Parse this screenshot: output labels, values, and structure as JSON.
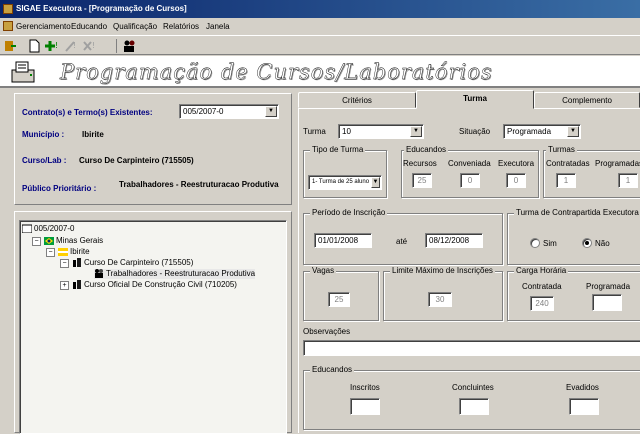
{
  "window": {
    "title": "SIGAE Executora - [Programação de Cursos]"
  },
  "menu": {
    "items": [
      "Gerenciamento",
      "Educando",
      "Qualificação",
      "Relatórios",
      "Janela"
    ]
  },
  "banner": {
    "title": "Programação de Cursos/Laboratórios"
  },
  "left": {
    "contract_label": "Contrato(s) e Termo(s) Existentes:",
    "contract_value": "005/2007-0",
    "municipio_label": "Município :",
    "municipio_value": "Ibirite",
    "curso_label": "Curso/Lab :",
    "curso_value": "Curso De Carpinteiro (715505)",
    "publico_label": "Público Prioritário :",
    "publico_value": "Trabalhadores - Reestruturacao Produtiva"
  },
  "tree": {
    "root": "005/2007-0",
    "state": "Minas Gerais",
    "city": "Ibirite",
    "course1": "Curso De Carpinteiro (715505)",
    "course1_child": "Trabalhadores - Reestruturacao Produtiva",
    "course2": "Curso Oficial De Construção Civil (710205)"
  },
  "tabs": {
    "criterios": "Critérios",
    "turma": "Turma",
    "complemento": "Complemento"
  },
  "turma": {
    "turma_label": "Turma",
    "turma_value": "10",
    "situacao_label": "Situação",
    "situacao_value": "Programada",
    "tipo_group": "Tipo de Turma",
    "tipo_value": "1- Turma de 25 aluno",
    "educandos_group": "Educandos",
    "recursos_label": "Recursos",
    "recursos_value": "25",
    "conveniada_label": "Conveniada",
    "conveniada_value": "0",
    "executora_label": "Executora",
    "executora_value": "0",
    "turmas_group": "Turmas",
    "contratadas_label": "Contratadas",
    "contratadas_value": "1",
    "programadas_label": "Programadas",
    "programadas_value": "1",
    "periodo_group": "Período de Inscrição",
    "data_inicio": "01/01/2008",
    "ate_label": "até",
    "data_fim": "08/12/2008",
    "contrapartida_group": "Turma de Contrapartida Executora",
    "sim_label": "Sim",
    "nao_label": "Não",
    "vagas_group": "Vagas",
    "vagas_value": "25",
    "limite_group": "Limite Máximo de Inscrições",
    "limite_value": "30",
    "carga_group": "Carga Horária",
    "carga_contratada_label": "Contratada",
    "carga_contratada_value": "240",
    "carga_programada_label": "Programada",
    "carga_programada_value": "",
    "observacoes_label": "Observações",
    "observacoes_value": "",
    "educandos2_group": "Educandos",
    "inscritos_label": "Inscritos",
    "concluintes_label": "Concluintes",
    "evadidos_label": "Evadidos"
  }
}
